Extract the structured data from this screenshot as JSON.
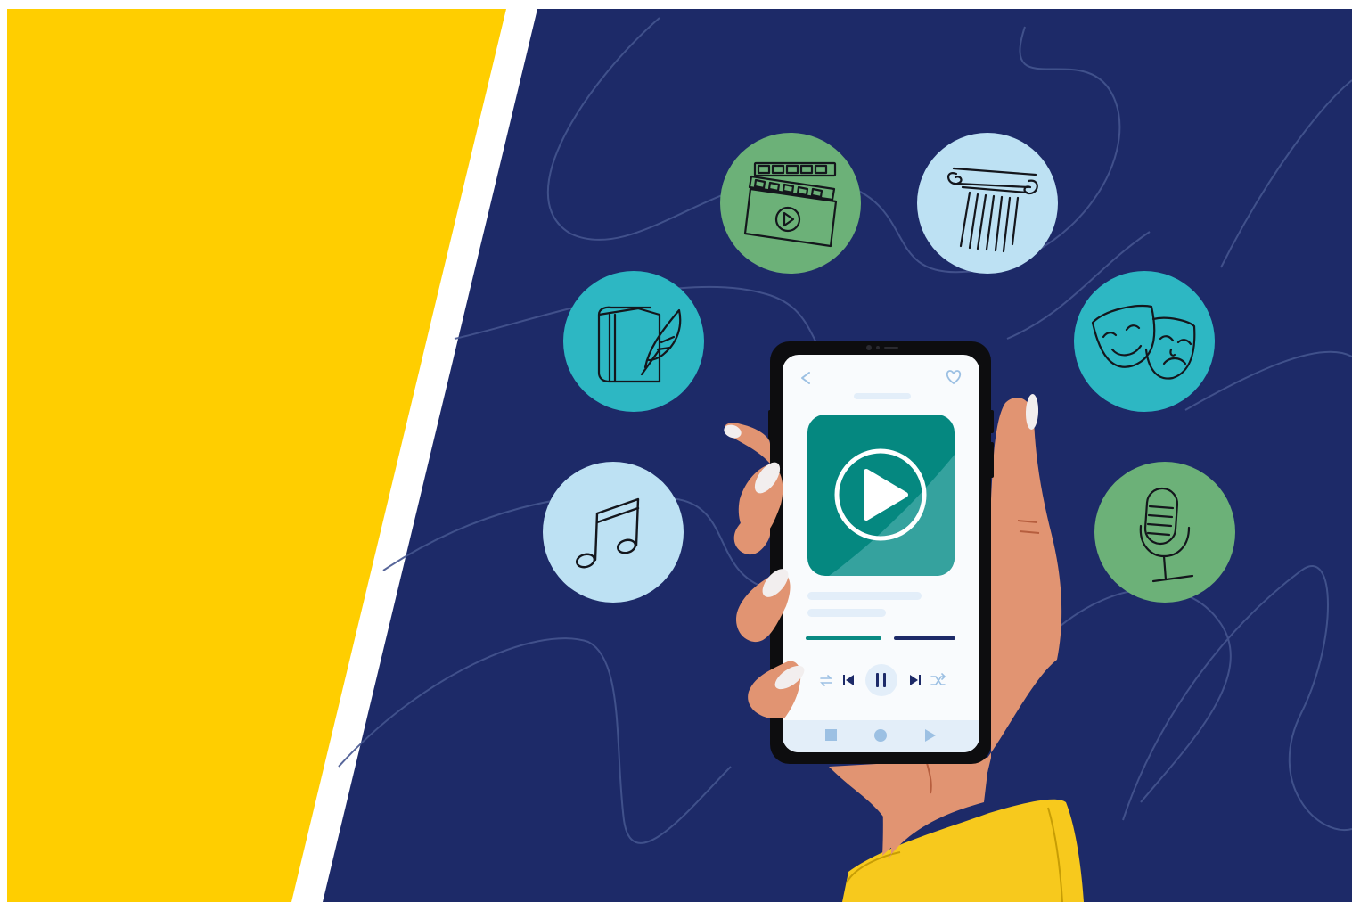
{
  "colors": {
    "frame": "#ffffff",
    "yellow_panel": "#ffce00",
    "navy_background": "#1d2a68",
    "squiggle": "#45558f",
    "phone_body": "#0d0d0f",
    "screen": "#f9fbfd",
    "cover_dark": "#058880",
    "cover_light": "#35a29e",
    "placeholder": "#e3eef9",
    "progress_played": "#0a8a83",
    "progress_remaining": "#1d2a68",
    "ui_icon": "#9cc0e3",
    "skin": "#e19472",
    "skin_line": "#b65e3e",
    "nail": "#f2eeee",
    "sleeve": "#f7c91d",
    "sleeve_shadow": "#c79d05",
    "circle_green": "#6cb178",
    "circle_teal": "#2db7c3",
    "circle_lightblue": "#bde1f3",
    "icon_stroke": "#14161c"
  },
  "category_icons": [
    {
      "name": "clapperboard-icon",
      "color": "circle_green"
    },
    {
      "name": "column-icon",
      "color": "circle_lightblue"
    },
    {
      "name": "book-quill-icon",
      "color": "circle_teal"
    },
    {
      "name": "theater-masks-icon",
      "color": "circle_teal"
    },
    {
      "name": "music-note-icon",
      "color": "circle_lightblue"
    },
    {
      "name": "microphone-icon",
      "color": "circle_green"
    }
  ],
  "player": {
    "progress_fraction": 0.55,
    "controls": [
      "repeat-icon",
      "previous-icon",
      "pause-icon",
      "next-icon",
      "shuffle-icon"
    ],
    "nav": [
      "stop-icon",
      "record-icon",
      "play-icon"
    ]
  }
}
